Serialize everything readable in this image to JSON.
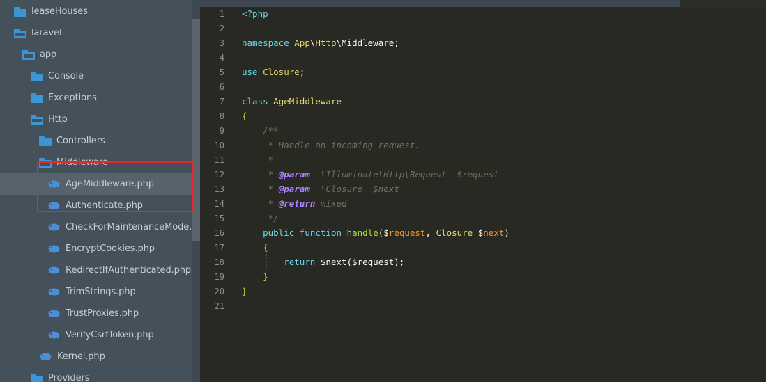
{
  "colors": {
    "sidebar_bg": "#44505a",
    "editor_bg": "#282923",
    "folder_icon": "#3c96d4",
    "php_icon": "#4d8fd6",
    "highlight_border": "#e8282a"
  },
  "sidebar": {
    "items": [
      {
        "label": "leaseHouses",
        "icon": "folder-icon"
      },
      {
        "label": "laravel",
        "icon": "folder-open-icon"
      },
      {
        "label": "app",
        "icon": "folder-open-icon"
      },
      {
        "label": "Console",
        "icon": "folder-icon"
      },
      {
        "label": "Exceptions",
        "icon": "folder-icon"
      },
      {
        "label": "Http",
        "icon": "folder-open-icon"
      },
      {
        "label": "Controllers",
        "icon": "folder-icon"
      },
      {
        "label": "Middleware",
        "icon": "folder-open-icon"
      },
      {
        "label": "AgeMiddleware.php",
        "icon": "php-file-icon",
        "selected": true
      },
      {
        "label": "Authenticate.php",
        "icon": "php-file-icon"
      },
      {
        "label": "CheckForMaintenanceMode.php",
        "icon": "php-file-icon"
      },
      {
        "label": "EncryptCookies.php",
        "icon": "php-file-icon"
      },
      {
        "label": "RedirectIfAuthenticated.php",
        "icon": "php-file-icon"
      },
      {
        "label": "TrimStrings.php",
        "icon": "php-file-icon"
      },
      {
        "label": "TrustProxies.php",
        "icon": "php-file-icon"
      },
      {
        "label": "VerifyCsrfToken.php",
        "icon": "php-file-icon"
      },
      {
        "label": "Kernel.php",
        "icon": "php-file-icon"
      },
      {
        "label": "Providers",
        "icon": "folder-icon"
      }
    ]
  },
  "editor": {
    "lines": [
      {
        "n": "1",
        "text": "<?php"
      },
      {
        "n": "2",
        "text": ""
      },
      {
        "n": "3",
        "text": "namespace App\\Http\\Middleware;"
      },
      {
        "n": "4",
        "text": ""
      },
      {
        "n": "5",
        "text": "use Closure;"
      },
      {
        "n": "6",
        "text": ""
      },
      {
        "n": "7",
        "text": "class AgeMiddleware"
      },
      {
        "n": "8",
        "text": "{"
      },
      {
        "n": "9",
        "text": "    /**"
      },
      {
        "n": "10",
        "text": "     * Handle an incoming request."
      },
      {
        "n": "11",
        "text": "     *"
      },
      {
        "n": "12",
        "text": "     * @param  \\Illuminate\\Http\\Request  $request"
      },
      {
        "n": "13",
        "text": "     * @param  \\Closure  $next"
      },
      {
        "n": "14",
        "text": "     * @return mixed"
      },
      {
        "n": "15",
        "text": "     */"
      },
      {
        "n": "16",
        "text": "    public function handle($request, Closure $next)"
      },
      {
        "n": "17",
        "text": "    {"
      },
      {
        "n": "18",
        "text": "        return $next($request);"
      },
      {
        "n": "19",
        "text": "    }"
      },
      {
        "n": "20",
        "text": "}"
      },
      {
        "n": "21",
        "text": ""
      }
    ]
  }
}
